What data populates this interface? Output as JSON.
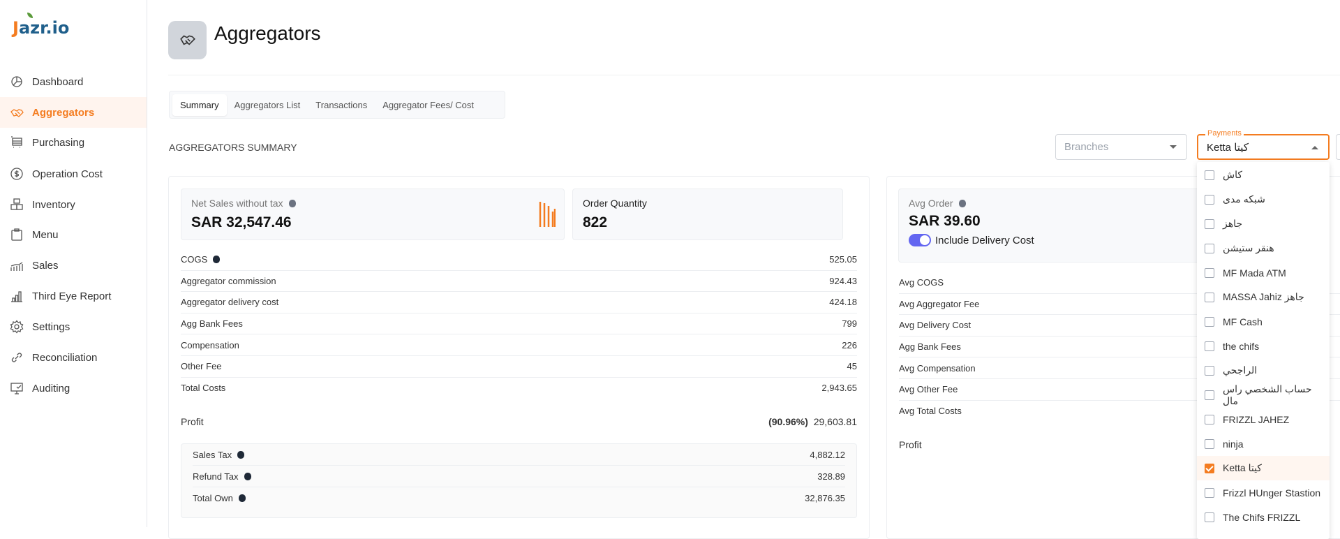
{
  "brand": {
    "logo_text": "Jazr.io"
  },
  "sidebar": {
    "items": [
      {
        "label": "Dashboard",
        "icon": "pie-chart-icon"
      },
      {
        "label": "Aggregators",
        "icon": "handshake-icon",
        "active": true
      },
      {
        "label": "Purchasing",
        "icon": "cart-icon"
      },
      {
        "label": "Operation Cost",
        "icon": "dollar-circle-icon"
      },
      {
        "label": "Inventory",
        "icon": "boxes-icon"
      },
      {
        "label": "Menu",
        "icon": "clipboard-icon"
      },
      {
        "label": "Sales",
        "icon": "sales-chart-icon"
      },
      {
        "label": "Third Eye Report",
        "icon": "bar-chart-icon"
      },
      {
        "label": "Settings",
        "icon": "gear-icon"
      },
      {
        "label": "Reconciliation",
        "icon": "link-icon"
      },
      {
        "label": "Auditing",
        "icon": "monitor-check-icon"
      }
    ]
  },
  "header": {
    "title": "Aggregators",
    "icon": "handshake-icon"
  },
  "tabs": [
    {
      "label": "Summary",
      "active": true
    },
    {
      "label": "Aggregators List"
    },
    {
      "label": "Transactions"
    },
    {
      "label": "Aggregator Fees/ Cost"
    }
  ],
  "summary": {
    "title": "AGGREGATORS SUMMARY",
    "filters": {
      "branches_placeholder": "Branches",
      "payments_label": "Payments",
      "payments_value": "Ketta كيتا"
    },
    "payments_options": [
      {
        "label": "كاش",
        "checked": false
      },
      {
        "label": "شبكه مدى",
        "checked": false
      },
      {
        "label": "جاهز",
        "checked": false
      },
      {
        "label": "هنقر ستيشن",
        "checked": false
      },
      {
        "label": "MF Mada ATM",
        "checked": false
      },
      {
        "label": "MASSA Jahiz جاهز",
        "checked": false
      },
      {
        "label": "MF Cash",
        "checked": false
      },
      {
        "label": "the chifs",
        "checked": false
      },
      {
        "label": "الراجحي",
        "checked": false
      },
      {
        "label": "حساب الشخصي راس مال",
        "checked": false
      },
      {
        "label": "FRIZZL JAHEZ",
        "checked": false
      },
      {
        "label": "ninja",
        "checked": false
      },
      {
        "label": "Ketta كيتا",
        "checked": true
      },
      {
        "label": "Frizzl HUnger Stastion",
        "checked": false
      },
      {
        "label": "The Chifs FRIZZL",
        "checked": false
      }
    ],
    "totals": {
      "net_sales": {
        "label": "Net Sales without tax",
        "value": "SAR 32,547.46"
      },
      "order_quantity": {
        "label": "Order Quantity",
        "value": "822"
      },
      "rows": [
        {
          "label": "COGS",
          "value": "525.05",
          "info": true
        },
        {
          "label": "Aggregator commission",
          "value": "924.43"
        },
        {
          "label": "Aggregator delivery cost",
          "value": "424.18"
        },
        {
          "label": "Agg Bank Fees",
          "value": "799"
        },
        {
          "label": "Compensation",
          "value": "226"
        },
        {
          "label": "Other Fee",
          "value": "45"
        },
        {
          "label": "Total Costs",
          "value": "2,943.65"
        }
      ],
      "profit": {
        "label": "Profit",
        "percent": "(90.96%)",
        "value": "29,603.81"
      },
      "tax_rows": [
        {
          "label": "Sales Tax",
          "value": "4,882.12"
        },
        {
          "label": "Refund Tax",
          "value": "328.89"
        },
        {
          "label": "Total Own",
          "value": "32,876.35"
        }
      ]
    },
    "averages": {
      "avg_order": {
        "label": "Avg Order",
        "value": "SAR 39.60"
      },
      "include_delivery": {
        "label": "Include Delivery Cost",
        "on": true
      },
      "rows": [
        {
          "label": "Avg COGS"
        },
        {
          "label": "Avg Aggregator Fee"
        },
        {
          "label": "Avg Delivery Cost"
        },
        {
          "label": "Agg Bank Fees"
        },
        {
          "label": "Avg Compensation"
        },
        {
          "label": "Avg Other Fee"
        },
        {
          "label": "Avg Total Costs"
        }
      ],
      "profit_label": "Profit"
    }
  },
  "colors": {
    "accent": "#f47c20",
    "toggle": "#6366f1",
    "brand_blue": "#1f5f8b"
  }
}
